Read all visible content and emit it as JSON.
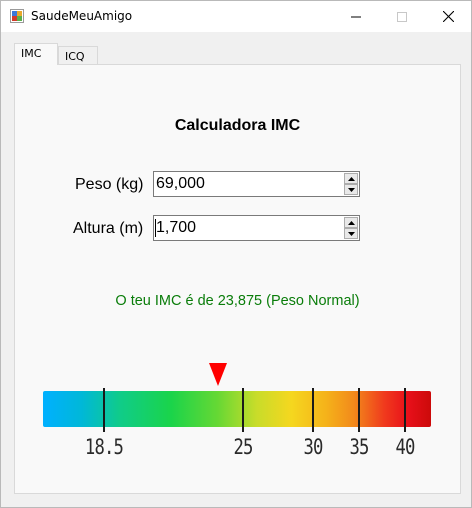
{
  "window": {
    "title": "SaudeMeuAmigo",
    "controls": {
      "minimize": "—",
      "maximize": "☐",
      "close": "✕"
    }
  },
  "tabs": [
    {
      "label": "IMC",
      "active": true
    },
    {
      "label": "ICQ",
      "active": false
    }
  ],
  "imc": {
    "heading": "Calculadora IMC",
    "peso": {
      "label": "Peso (kg)",
      "value": "69,000"
    },
    "altura": {
      "label": "Altura (m)",
      "value": "1,700"
    },
    "result": "O teu IMC é de 23,875 (Peso Normal)",
    "result_color": "#0a7d0a",
    "gauge": {
      "ticks": [
        "18.5",
        "25",
        "30",
        "35",
        "40"
      ],
      "pointer_color": "#ff0000",
      "value": 23.875
    }
  }
}
